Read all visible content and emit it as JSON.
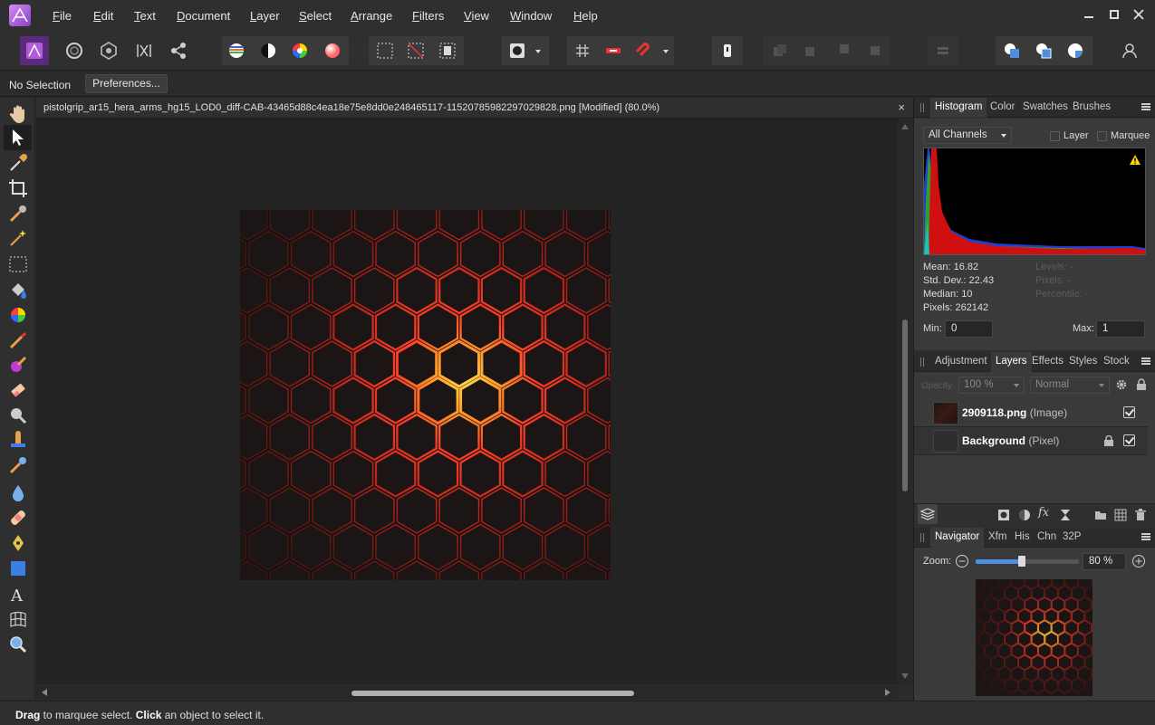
{
  "menu": [
    "File",
    "Edit",
    "Text",
    "Document",
    "Layer",
    "Select",
    "Arrange",
    "Filters",
    "View",
    "Window",
    "Help"
  ],
  "context": {
    "selection": "No Selection",
    "preferences": "Preferences..."
  },
  "document": {
    "title": "pistolgrip_ar15_hera_arms_hg15_LOD0_diff-CAB-43465d88c4ea18e75e8dd0e248465117-11520785982297029828.png [Modified] (80.0%)",
    "close": "×"
  },
  "status": {
    "drag": "Drag",
    "drag_rest": " to marquee select. ",
    "click": "Click",
    "click_rest": " an object to select it."
  },
  "histogram": {
    "tabs": [
      "Histogram",
      "Color",
      "Swatches",
      "Brushes"
    ],
    "channel": "All Channels",
    "layer_label": "Layer",
    "marquee_label": "Marquee",
    "stats": {
      "mean": "Mean: 16.82",
      "std": "Std. Dev.: 22.43",
      "median": "Median: 10",
      "pixels": "Pixels: 262142"
    },
    "stats_right": {
      "levels": "Levels: -",
      "pixels": "Pixels: -",
      "percentile": "Percentile: -"
    },
    "min_label": "Min:",
    "min_value": "0",
    "max_label": "Max:",
    "max_value": "1"
  },
  "layers_panel": {
    "tabs": [
      "Adjustment",
      "Layers",
      "Effects",
      "Styles",
      "Stock"
    ],
    "opacity": "100 %",
    "opacity_label": "Opacity:",
    "blend": "Normal",
    "layers": [
      {
        "name": "2909118.png",
        "type": " (Image)"
      },
      {
        "name": "Background",
        "type": " (Pixel)"
      }
    ]
  },
  "navigator": {
    "tabs": [
      "Navigator",
      "Xfm",
      "His",
      "Chn",
      "32P"
    ],
    "zoom_label": "Zoom:",
    "zoom_value": "80 %",
    "zoom_level": 0.45
  },
  "colors": {
    "accent": "#4f8fe0",
    "glow": "#ff5a2a",
    "panel": "#2f2f2f"
  }
}
